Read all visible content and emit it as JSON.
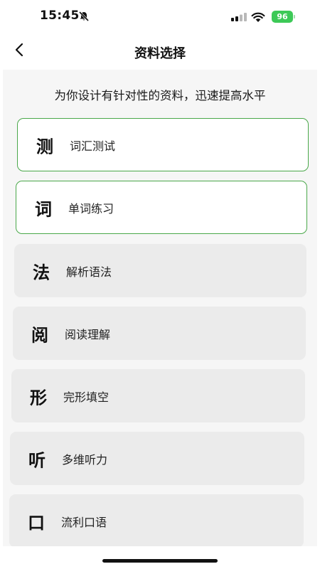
{
  "status_bar": {
    "time": "15:45",
    "battery": "96"
  },
  "header": {
    "title": "资料选择"
  },
  "main": {
    "subtitle": "为你设计有针对性的资料，迅速提高水平",
    "items": [
      {
        "char": "测",
        "label": "词汇测试",
        "selected": true
      },
      {
        "char": "词",
        "label": "单词练习",
        "selected": true
      },
      {
        "char": "法",
        "label": "解析语法",
        "selected": false
      },
      {
        "char": "阅",
        "label": "阅读理解",
        "selected": false
      },
      {
        "char": "形",
        "label": "完形填空",
        "selected": false
      },
      {
        "char": "听",
        "label": "多维听力",
        "selected": false
      },
      {
        "char": "口",
        "label": "流利口语",
        "selected": false
      }
    ]
  },
  "colors": {
    "accent": "#4aa84a",
    "battery": "#3dc957",
    "card_bg": "#ebebeb",
    "content_bg": "#f6f6f6"
  },
  "icons": {
    "back": "chevron-left-icon",
    "silent": "bell-slash-icon",
    "signal": "cellular-signal-icon",
    "wifi": "wifi-icon"
  }
}
